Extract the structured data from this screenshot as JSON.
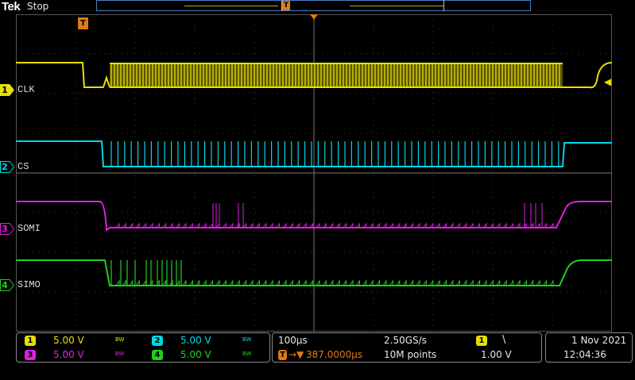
{
  "header": {
    "logo": "Tek",
    "status": "Stop"
  },
  "trigger_marker": "T",
  "channels": [
    {
      "num": "1",
      "label": "CLK",
      "color": "#e8e000"
    },
    {
      "num": "2",
      "label": "CS",
      "color": "#00d8e8"
    },
    {
      "num": "3",
      "label": "SOMI",
      "color": "#e020e0"
    },
    {
      "num": "4",
      "label": "SIMO",
      "color": "#20d020"
    }
  ],
  "vertical": {
    "ch1": {
      "num": "1",
      "scale": "5.00 V"
    },
    "ch2": {
      "num": "2",
      "scale": "5.00 V"
    },
    "ch3": {
      "num": "3",
      "scale": "5.00 V"
    },
    "ch4": {
      "num": "4",
      "scale": "5.00 V"
    },
    "bw_label": "BW"
  },
  "horizontal": {
    "timebase": "100µs",
    "trigger_pos": "387.0000µs",
    "sample_rate": "2.50GS/s",
    "record_length": "10M points"
  },
  "trigger": {
    "source": "1",
    "slope_symbol": "\\",
    "level": "1.00 V"
  },
  "datetime": {
    "date": "1 Nov 2021",
    "time": "12:04:36"
  }
}
